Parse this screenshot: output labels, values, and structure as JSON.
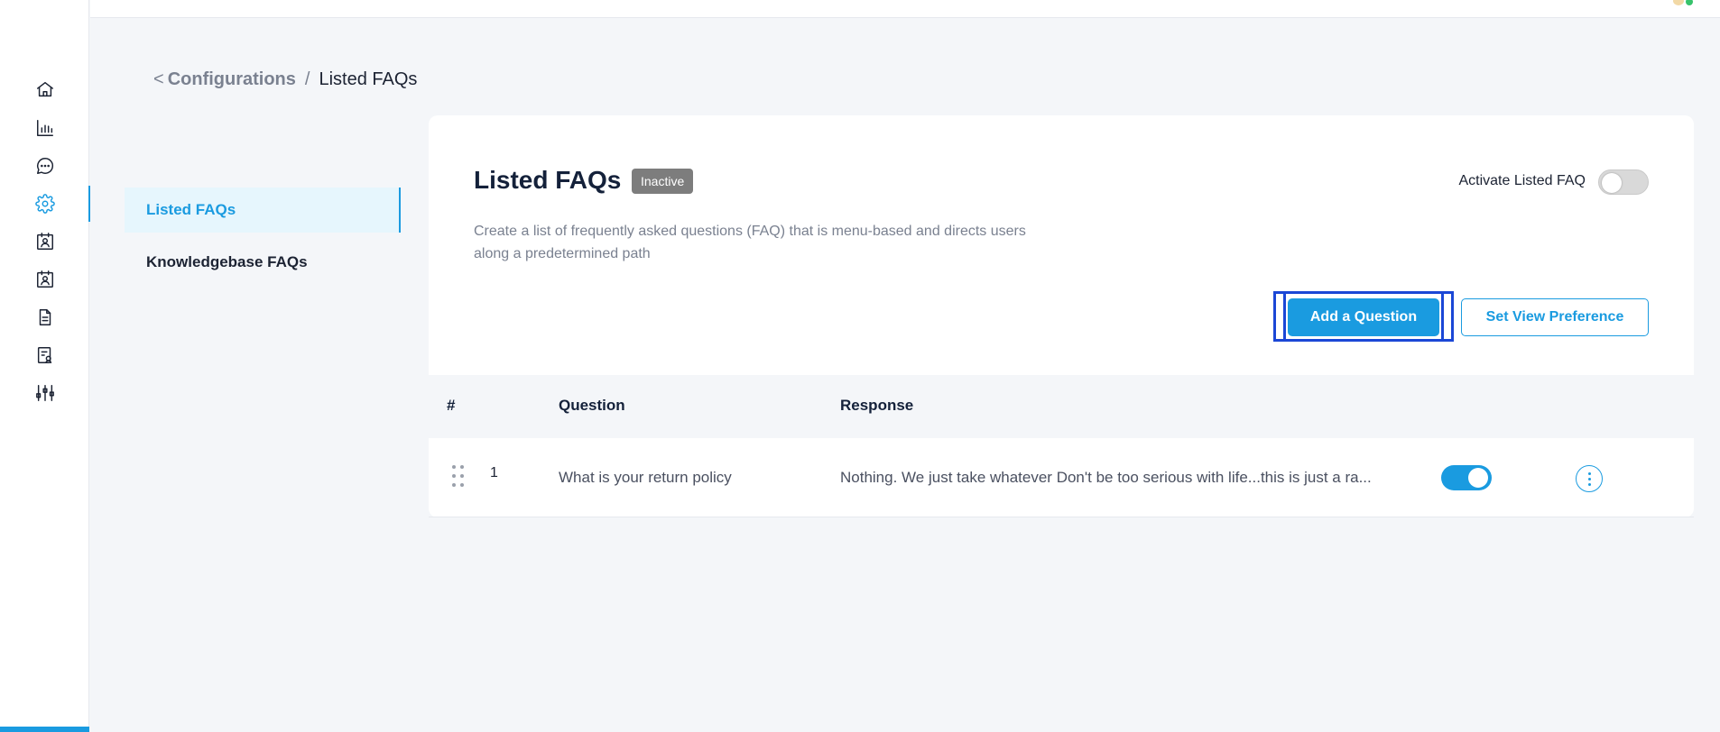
{
  "breadcrumb": {
    "back_glyph": "<",
    "parent": "Configurations",
    "separator": "/",
    "current": "Listed FAQs"
  },
  "sidebar_icons": [
    "home-icon",
    "analytics-icon",
    "chat-icon",
    "settings-icon",
    "contact-card-icon",
    "agent-card-icon",
    "document-icon",
    "report-icon",
    "sliders-icon"
  ],
  "subnav": {
    "items": [
      {
        "label": "Listed FAQs",
        "active": true
      },
      {
        "label": "Knowledgebase FAQs",
        "active": false
      }
    ]
  },
  "card": {
    "title": "Listed FAQs",
    "status": "Inactive",
    "activate_label": "Activate Listed FAQ",
    "activate_on": false,
    "description": "Create a list of frequently asked questions (FAQ) that is menu-based and directs users along a predetermined path",
    "add_button": "Add a Question",
    "view_pref_button": "Set View Preference"
  },
  "table": {
    "headers": {
      "num": "#",
      "question": "Question",
      "response": "Response"
    },
    "rows": [
      {
        "num": "1",
        "question": "What is your return policy",
        "response": "Nothing. We just take whatever Don't be too serious with life...this is just a ra...",
        "enabled": true
      }
    ]
  },
  "colors": {
    "accent": "#1a9be0",
    "badge_inactive": "#7d7d7d",
    "highlight": "#1b47d6"
  }
}
